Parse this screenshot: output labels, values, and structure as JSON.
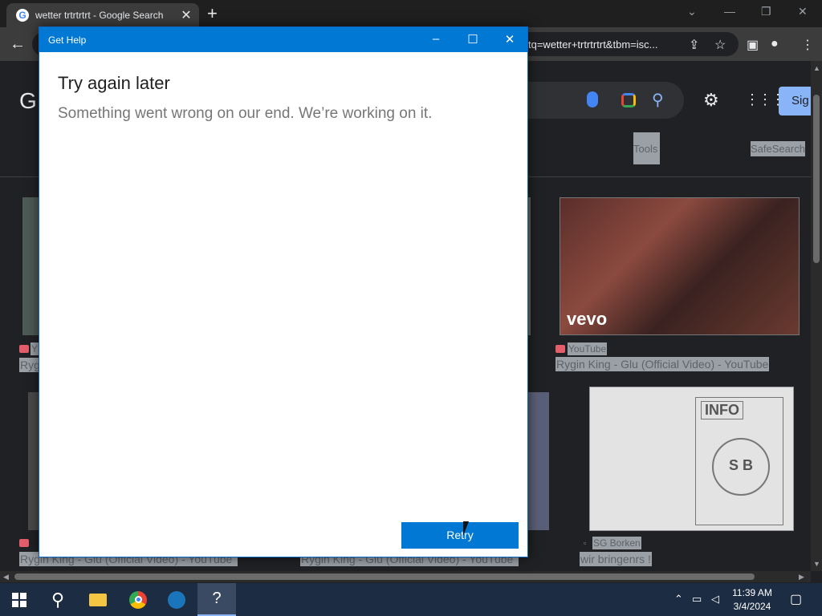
{
  "browser": {
    "tab_title": "wetter trtrtrtrt - Google Search",
    "tab_favicon": "G",
    "new_tab": "+",
    "url_fragment": "tq=wetter+trtrtrtrt&tbm=isc..."
  },
  "google": {
    "logo_partial": "G",
    "signin_partial": "Sig",
    "tools": "Tools",
    "safesearch": "SafeSearch",
    "results": [
      {
        "source": "YouTube",
        "title": "Rygin King - Glu (Official Video) - YouTube",
        "thumb_label": "vevo"
      },
      {
        "source": "SG Borken",
        "title": "wir bringenrs !",
        "doc_badge": "INFO",
        "doc_seal": "S B"
      },
      {
        "source_partial": "Y",
        "title_partial": "Ryg"
      },
      {
        "title_partial_1": "Rygin King - Glu (Official Video) - YouTube",
        "title_partial_2": "Rygin King - Glu (Official Video) - YouTube"
      }
    ]
  },
  "dialog": {
    "window_title": "Get Help",
    "heading": "Try again later",
    "message": "Something went wrong on our end. We’re working on it.",
    "retry_label": "Retry"
  },
  "taskbar": {
    "time": "11:39 AM",
    "date": "3/4/2024"
  }
}
